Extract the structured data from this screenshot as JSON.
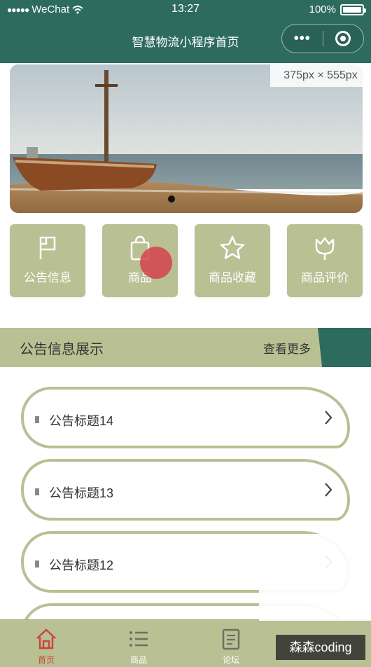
{
  "status_bar": {
    "carrier": "WeChat",
    "time": "13:27",
    "battery": "100%"
  },
  "nav": {
    "title": "智慧物流小程序首页",
    "more_glyph": "•••"
  },
  "size_overlay": "375px × 555px",
  "banner": {
    "indicator_count": 1,
    "active_index": 0
  },
  "quick_menu": [
    {
      "label": "公告信息",
      "icon": "flag-icon"
    },
    {
      "label": "商品",
      "icon": "shopping-bag-icon"
    },
    {
      "label": "商品收藏",
      "icon": "star-icon"
    },
    {
      "label": "商品评价",
      "icon": "tulip-icon"
    }
  ],
  "section": {
    "title": "公告信息展示",
    "more_label": "查看更多"
  },
  "notices": [
    {
      "title": "公告标题14"
    },
    {
      "title": "公告标题13"
    },
    {
      "title": "公告标题12"
    }
  ],
  "tabbar": [
    {
      "label": "首页",
      "icon": "home-icon",
      "active": true
    },
    {
      "label": "商品",
      "icon": "list-icon",
      "active": false
    },
    {
      "label": "论坛",
      "icon": "document-icon",
      "active": false
    }
  ],
  "watermark": "森森coding",
  "colors": {
    "primary": "#2e6b5f",
    "accent": "#b9c093",
    "active_tab": "#c9463e"
  }
}
